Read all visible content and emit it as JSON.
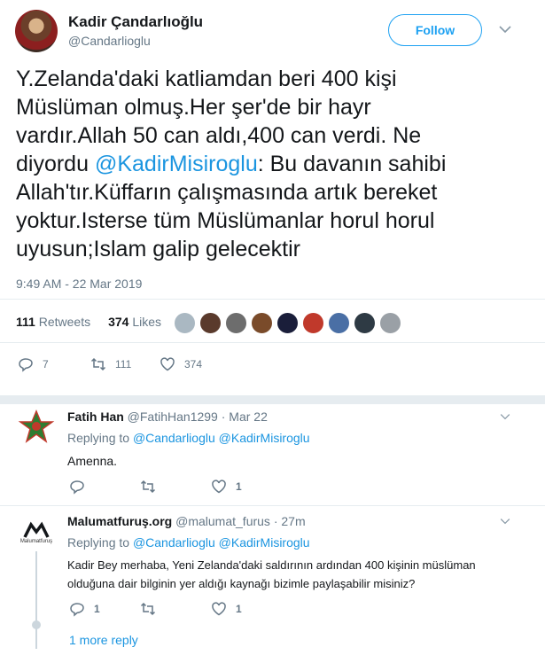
{
  "author": {
    "name": "Kadir Çandarlıoğlu",
    "handle": "@Candarlioglu",
    "follow_label": "Follow"
  },
  "tweet": {
    "lines": [
      "Y.Zelanda'daki katliamdan beri 400 kişi",
      "Müslüman olmuş.Her şer'de bir hayr",
      "vardır.Allah 50 can aldı,400 can verdi. Ne",
      "Bu davanın sahibi",
      "Allah'tır.Küffarın çalışmasında artık bereket",
      "yoktur.Isterse tüm Müslümanlar horul horul",
      "uyusun;Islam galip gelecektir"
    ],
    "line4_prefix": "diyordu",
    "mention": "@KadirMisiroglu",
    "line4_suffix": ":",
    "time": "9:49 AM - 22 Mar 2019"
  },
  "stats": {
    "retweets_count": "111",
    "retweets_label": "Retweets",
    "likes_count": "374",
    "likes_label": "Likes"
  },
  "actions": {
    "replies": "7",
    "retweets": "111",
    "likes": "374"
  },
  "colors": {
    "accent": "#1da1f2",
    "link": "#1b95e0",
    "muted": "#657786",
    "divider": "#e6ecf0"
  },
  "replies": [
    {
      "name": "Fatih Han",
      "handle": "@FatihHan1299",
      "time": "· Mar 22",
      "replying_label": "Replying to",
      "replying_to": [
        "@Candarlioglu",
        "@KadirMisiroglu"
      ],
      "text": "Amenna.",
      "reply_count": "",
      "retweet_count": "",
      "like_count": "1"
    },
    {
      "name": "Malumatfuruş.org",
      "handle": "@malumat_furus",
      "time": "· 27m",
      "replying_label": "Replying to",
      "replying_to": [
        "@Candarlioglu",
        "@KadirMisiroglu"
      ],
      "text_lines": [
        "Kadir Bey merhaba, Yeni Zelanda'daki saldırının ardından 400 kişinin müslüman",
        "olduğuna dair bilginin yer aldığı kaynağı bizimle paylaşabilir misiniz?"
      ],
      "avatar_caption": "Malumatfuruş",
      "reply_count": "1",
      "retweet_count": "",
      "like_count": "1",
      "more_replies": "1 more reply"
    }
  ]
}
